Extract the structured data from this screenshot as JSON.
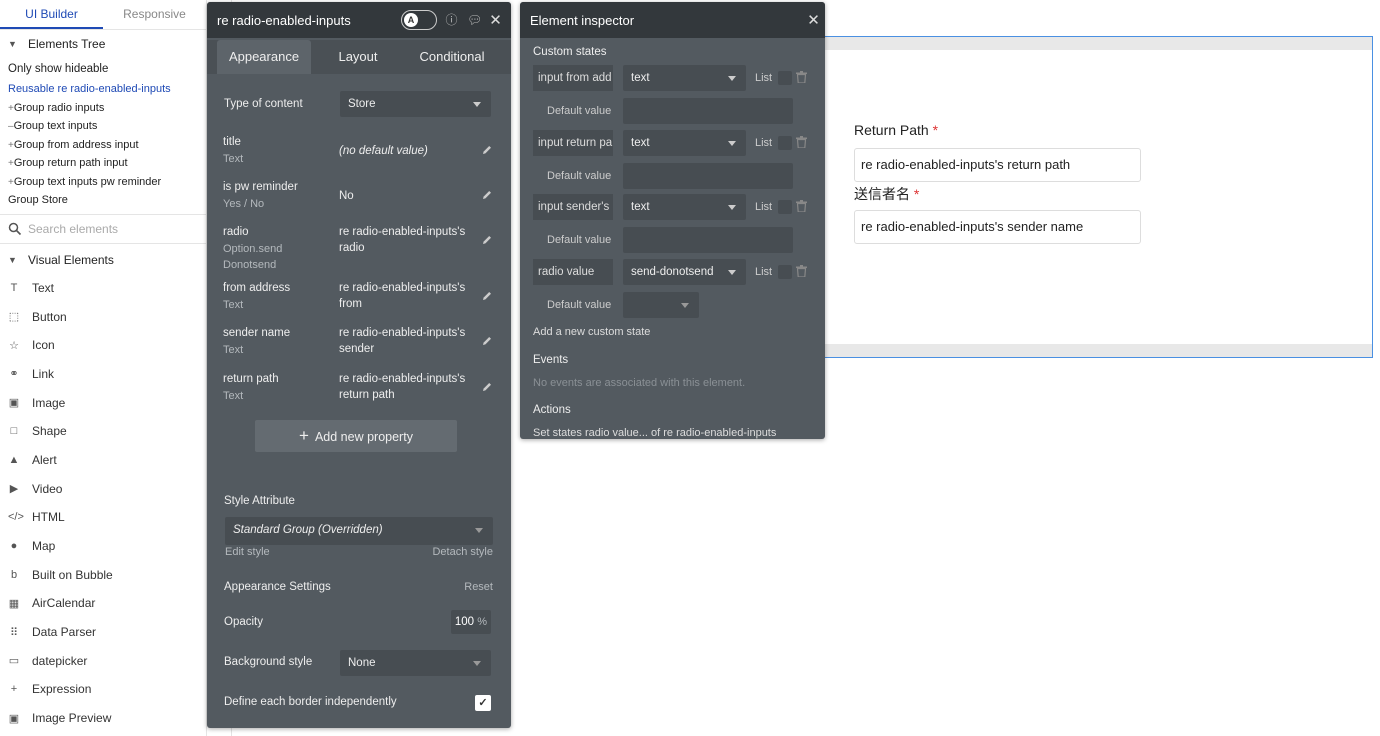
{
  "sidebar": {
    "tabs": [
      "UI Builder",
      "Responsive"
    ],
    "elements_tree_label": "Elements Tree",
    "only_show_hideable": "Only show hideable",
    "tree": [
      {
        "prefix": "",
        "label": "Reusable re radio-enabled-inputs"
      },
      {
        "prefix": "+",
        "label": "Group radio inputs"
      },
      {
        "prefix": "–",
        "label": "Group text inputs"
      },
      {
        "prefix": "+",
        "label": "Group from address input"
      },
      {
        "prefix": "+",
        "label": "Group return path input"
      },
      {
        "prefix": "+",
        "label": "Group text inputs pw reminder"
      },
      {
        "prefix": "",
        "label": "Group Store"
      }
    ],
    "search_placeholder": "Search elements",
    "visual_elements_label": "Visual Elements",
    "visual_elements": [
      {
        "icon": "T",
        "label": "Text"
      },
      {
        "icon": "⬚",
        "label": "Button"
      },
      {
        "icon": "☆",
        "label": "Icon"
      },
      {
        "icon": "⚭",
        "label": "Link"
      },
      {
        "icon": "▣",
        "label": "Image"
      },
      {
        "icon": "□",
        "label": "Shape"
      },
      {
        "icon": "▲",
        "label": "Alert"
      },
      {
        "icon": "▶",
        "label": "Video"
      },
      {
        "icon": "</>",
        "label": "HTML"
      },
      {
        "icon": "●",
        "label": "Map"
      },
      {
        "icon": "b",
        "label": "Built on Bubble"
      },
      {
        "icon": "▦",
        "label": "AirCalendar"
      },
      {
        "icon": "⠿",
        "label": "Data Parser"
      },
      {
        "icon": "▭",
        "label": "datepicker"
      },
      {
        "icon": "+",
        "label": "Expression"
      },
      {
        "icon": "▣",
        "label": "Image Preview"
      }
    ]
  },
  "property_editor": {
    "title": "re radio-enabled-inputs",
    "tabs": [
      "Appearance",
      "Layout",
      "Conditional"
    ],
    "type_of_content_label": "Type of content",
    "type_of_content_value": "Store",
    "properties": [
      {
        "name": "title",
        "type": "Text",
        "value": "(no default value)",
        "italic": true
      },
      {
        "name": "is pw reminder",
        "type": "Yes / No",
        "value": "No"
      },
      {
        "name": "radio",
        "type": "Option.send Donotsend",
        "value": "re radio-enabled-inputs's radio"
      },
      {
        "name": "from address",
        "type": "Text",
        "value": "re radio-enabled-inputs's from"
      },
      {
        "name": "sender name",
        "type": "Text",
        "value": "re radio-enabled-inputs's sender"
      },
      {
        "name": "return path",
        "type": "Text",
        "value": "re radio-enabled-inputs's return path"
      }
    ],
    "add_property_label": "Add new property",
    "style_attribute_label": "Style Attribute",
    "style_value": "Standard Group (Overridden)",
    "edit_style": "Edit style",
    "detach_style": "Detach style",
    "appearance_settings": "Appearance Settings",
    "reset": "Reset",
    "opacity_label": "Opacity",
    "opacity_value": "100",
    "opacity_unit": "%",
    "background_style_label": "Background style",
    "background_style_value": "None",
    "define_border_label": "Define each border independently",
    "define_border_checked": true
  },
  "inspector": {
    "title": "Element inspector",
    "custom_states_label": "Custom states",
    "states": [
      {
        "name": "input from add",
        "type": "text",
        "default": ""
      },
      {
        "name": "input return pa",
        "type": "text",
        "default": ""
      },
      {
        "name": "input sender's",
        "type": "text",
        "default": ""
      },
      {
        "name": "radio value",
        "type": "send-donotsend",
        "default": ""
      }
    ],
    "list_label": "List",
    "default_value_label": "Default value",
    "add_state": "Add a new custom state",
    "events_label": "Events",
    "events_empty": "No events are associated with this element.",
    "actions_label": "Actions",
    "actions_text": "Set states radio value... of re radio-enabled-inputs"
  },
  "canvas": {
    "return_path_label": "Return Path",
    "return_path_value": "re radio-enabled-inputs's return path",
    "sender_label": "送信者名",
    "sender_value": "re radio-enabled-inputs's sender name",
    "required_mark": "*"
  }
}
